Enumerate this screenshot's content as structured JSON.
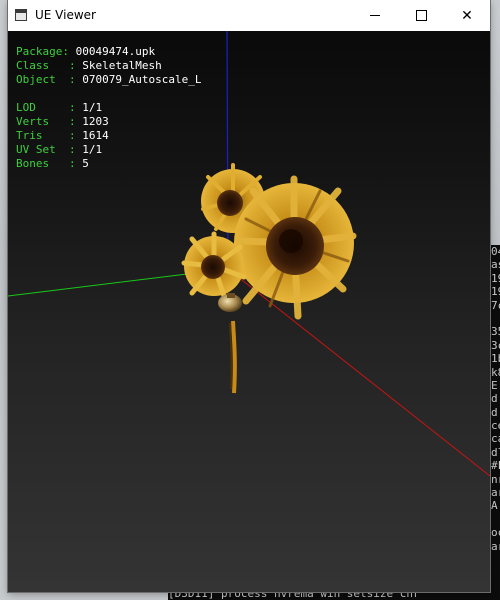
{
  "window": {
    "title": "UE Viewer",
    "controls": {
      "minimize": "minimize",
      "maximize": "maximize",
      "close": "✕"
    }
  },
  "info": {
    "package": {
      "key": "Package: ",
      "value": "00049474.upk"
    },
    "class": {
      "key": "Class   : ",
      "value": "SkeletalMesh"
    },
    "object": {
      "key": "Object  : ",
      "value": "070079_Autoscale_L"
    },
    "lod": {
      "key": "LOD     : ",
      "value": "1/1"
    },
    "verts": {
      "key": "Verts   : ",
      "value": "1203"
    },
    "tris": {
      "key": "Tris    : ",
      "value": "1614"
    },
    "uvset": {
      "key": "UV Set  : ",
      "value": "1/1"
    },
    "bones": {
      "key": "Bones   : ",
      "value": "5"
    }
  },
  "console": {
    "lines": [
      "04",
      "as",
      "19",
      "19",
      "7c",
      "",
      "35",
      "3c",
      "1b",
      "k8",
      "E",
      "d",
      "d",
      "ce",
      "ca",
      "dl",
      "#F",
      "nr",
      "ar",
      "A",
      "",
      "oc",
      "ar"
    ],
    "bottom": "[D3D11] process  nvrema win setsize  chr"
  },
  "colors": {
    "info_key": "#3fcf3f",
    "info_value": "#ffffff",
    "axis_x": "#c81414",
    "axis_y": "#18c818",
    "axis_z": "#1e1ec8",
    "petal": "#d9a31c",
    "flower_center": "#3a1c08"
  }
}
